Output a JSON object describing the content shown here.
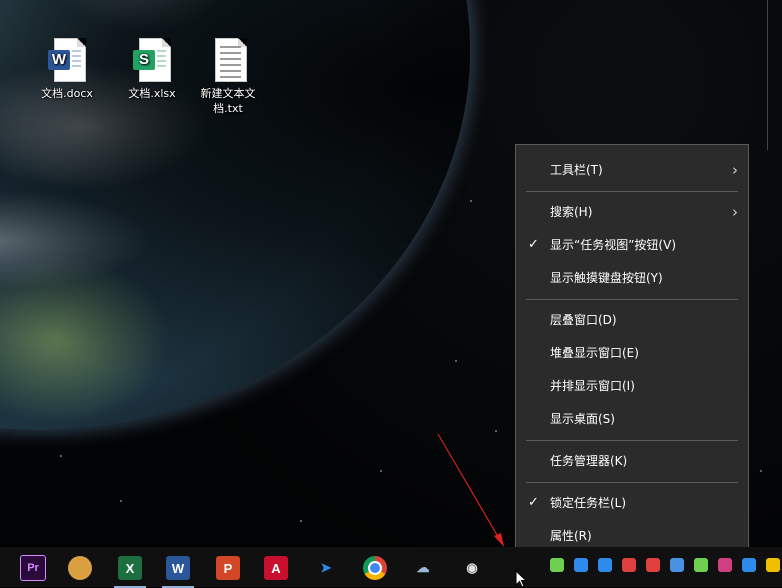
{
  "desktop": {
    "icons": [
      {
        "label": "文档.docx",
        "icon": "word-doc-icon",
        "badge": "W",
        "color": "#2b579a"
      },
      {
        "label": "文档.xlsx",
        "icon": "excel-doc-icon",
        "badge": "S",
        "color": "#21a366"
      },
      {
        "label": "新建文本文档.txt",
        "icon": "text-file-icon"
      }
    ]
  },
  "context_menu": {
    "items": [
      {
        "label": "工具栏(T)",
        "submenu": true
      },
      {
        "label": "搜索(H)",
        "submenu": true
      },
      {
        "label": "显示“任务视图”按钮(V)",
        "checked": true
      },
      {
        "label": "显示触摸键盘按钮(Y)"
      },
      {
        "label": "层叠窗口(D)"
      },
      {
        "label": "堆叠显示窗口(E)"
      },
      {
        "label": "并排显示窗口(I)"
      },
      {
        "label": "显示桌面(S)"
      },
      {
        "label": "任务管理器(K)"
      },
      {
        "label": "锁定任务栏(L)",
        "checked": true
      },
      {
        "label": "属性(R)"
      }
    ]
  },
  "taskbar": {
    "apps": [
      {
        "name": "premiere-pro-icon",
        "glyph": "Pr",
        "color": "#2a0a3a",
        "fg": "#d98cff",
        "running": false
      },
      {
        "name": "app-icon",
        "glyph": "",
        "color": "#d8a040",
        "fg": "#fff",
        "running": false
      },
      {
        "name": "excel-icon",
        "glyph": "X",
        "color": "#1d6f42",
        "fg": "#fff",
        "running": true
      },
      {
        "name": "word-icon",
        "glyph": "W",
        "color": "#2b579a",
        "fg": "#fff",
        "running": true
      },
      {
        "name": "powerpoint-icon",
        "glyph": "P",
        "color": "#d24726",
        "fg": "#fff",
        "running": false
      },
      {
        "name": "autocad-icon",
        "glyph": "A",
        "color": "#c8102e",
        "fg": "#fff",
        "running": false
      },
      {
        "name": "send-icon",
        "glyph": "➤",
        "color": "#101010",
        "fg": "#2d8ceb",
        "running": false
      },
      {
        "name": "chrome-icon",
        "glyph": "",
        "color": "#db4437",
        "fg": "#fff",
        "running": false
      },
      {
        "name": "cloud-icon",
        "glyph": "☁",
        "color": "#101010",
        "fg": "#9bb8d6",
        "running": false
      },
      {
        "name": "camera-icon",
        "glyph": "◉",
        "color": "#101010",
        "fg": "#e0e0e0",
        "running": false
      }
    ],
    "tray_colors": [
      "#6fcf4f",
      "#2d8ceb",
      "#2d8ceb",
      "#e04040",
      "#e04040",
      "#4a90e2",
      "#6fcf4f",
      "#d04080",
      "#2d8ceb",
      "#f0c000"
    ]
  }
}
